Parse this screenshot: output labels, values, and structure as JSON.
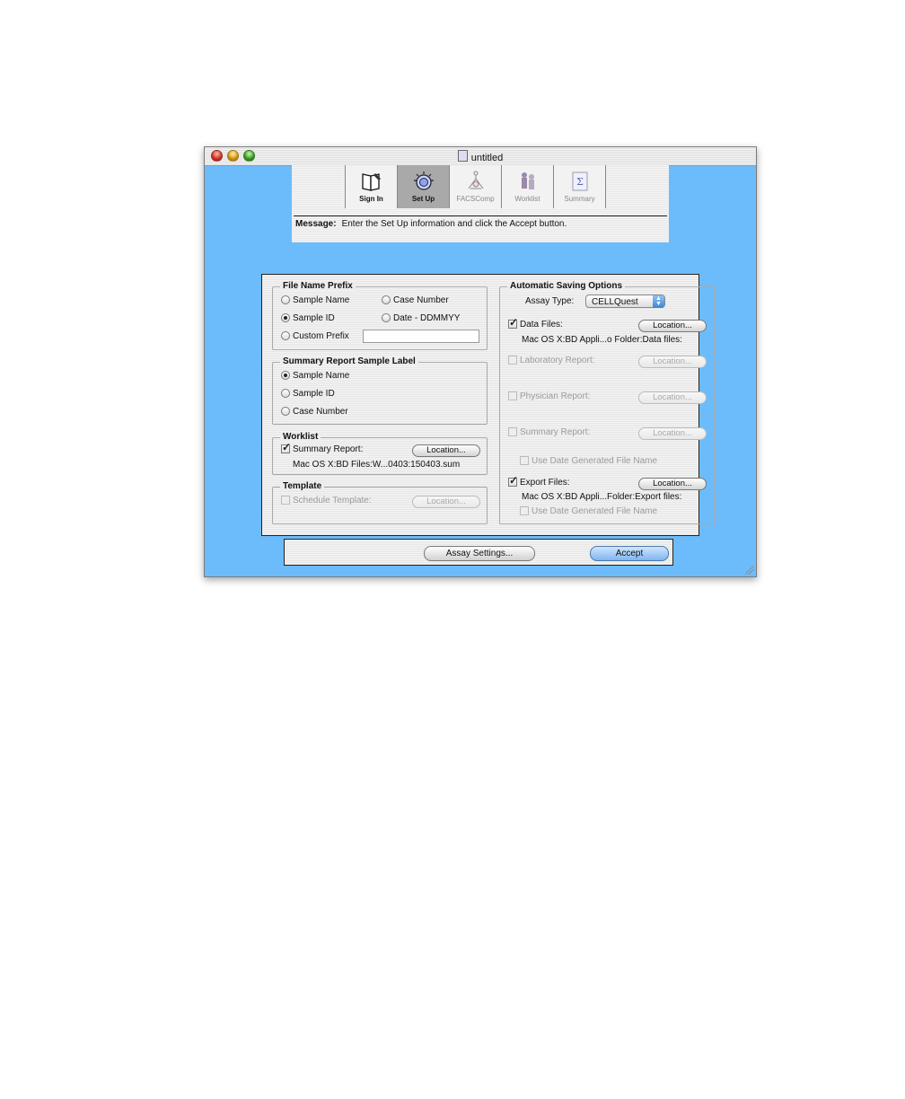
{
  "window": {
    "title": "untitled"
  },
  "tabs": [
    {
      "label": "Sign In",
      "icon": "book-icon",
      "state": "normal"
    },
    {
      "label": "Set Up",
      "icon": "setup-icon",
      "state": "active"
    },
    {
      "label": "FACSComp",
      "icon": "facscomp-icon",
      "state": "dim"
    },
    {
      "label": "Worklist",
      "icon": "worklist-icon",
      "state": "dim"
    },
    {
      "label": "Summary",
      "icon": "summary-icon",
      "state": "dim"
    }
  ],
  "message": {
    "label": "Message:",
    "text": "Enter the Set Up information and click the Accept button."
  },
  "file_name_prefix": {
    "title": "File Name Prefix",
    "options": {
      "sample_name": "Sample Name",
      "case_number": "Case Number",
      "sample_id": "Sample ID",
      "date": "Date - DDMMYY",
      "custom_prefix": "Custom Prefix"
    },
    "selected": "Sample ID",
    "custom_prefix_value": ""
  },
  "summary_label": {
    "title": "Summary Report Sample Label",
    "options": {
      "sample_name": "Sample Name",
      "sample_id": "Sample ID",
      "case_number": "Case Number"
    },
    "selected": "Sample Name"
  },
  "worklist": {
    "title": "Worklist",
    "summary_report": "Summary Report:",
    "summary_report_checked": true,
    "location_button": "Location...",
    "path": "Mac OS X:BD Files:W...0403:150403.sum"
  },
  "template": {
    "title": "Template",
    "schedule_template": "Schedule Template:",
    "location_button": "Location..."
  },
  "auto_saving": {
    "title": "Automatic Saving Options",
    "assay_type_label": "Assay Type:",
    "assay_type_value": "CELLQuest",
    "data_files": "Data Files:",
    "data_files_path": "Mac OS X:BD Appli...o Folder:Data files:",
    "laboratory_report": "Laboratory Report:",
    "physician_report": "Physician Report:",
    "summary_report": "Summary Report:",
    "use_date_generated": "Use Date Generated File Name",
    "export_files": "Export Files:",
    "export_files_path": "Mac OS X:BD Appli...Folder:Export files:",
    "use_date_generated_2": "Use Date Generated File Name",
    "location_button": "Location..."
  },
  "bottom": {
    "assay_settings": "Assay Settings...",
    "accept": "Accept"
  },
  "colors": {
    "window_background": "#6cbcfb",
    "accent": "#7fb5ee"
  }
}
